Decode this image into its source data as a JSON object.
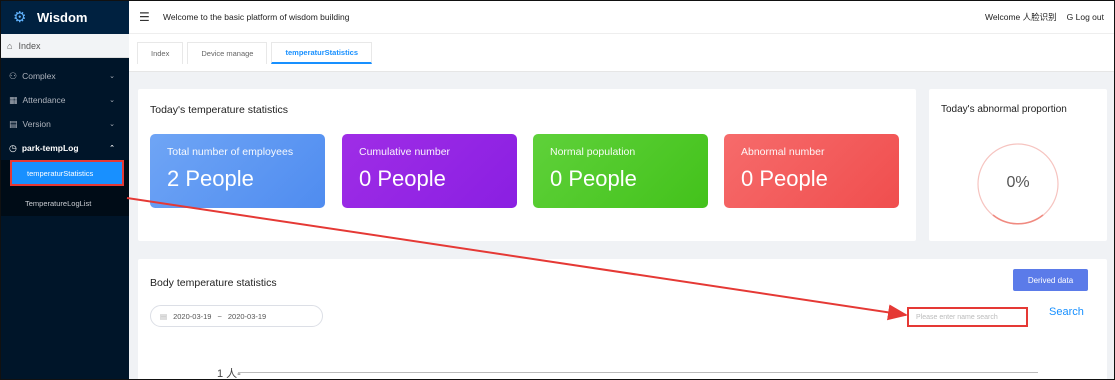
{
  "app": {
    "name": "Wisdom"
  },
  "header": {
    "welcome_text": "Welcome to the basic platform of wisdom building",
    "user_greeting": "Welcome 人脸识别",
    "logout_label": "Log out"
  },
  "sidebar": {
    "index_label": "Index",
    "items": [
      {
        "label": "Complex",
        "icon": "cluster-icon"
      },
      {
        "label": "Attendance",
        "icon": "calendar-icon"
      },
      {
        "label": "Version",
        "icon": "document-icon"
      },
      {
        "label": "park-tempLog",
        "icon": "clock-icon"
      }
    ],
    "sub_items": [
      {
        "label": "temperaturStatistics"
      },
      {
        "label": "TemperatureLogList"
      }
    ]
  },
  "tabs": [
    {
      "label": "Index"
    },
    {
      "label": "Device manage"
    },
    {
      "label": "temperaturStatistics"
    }
  ],
  "stats": {
    "title": "Today's temperature statistics",
    "cards": [
      {
        "label": "Total number of employees",
        "value": "2 People",
        "color": "#5b95f2"
      },
      {
        "label": "Cumulative number",
        "value": "0 People",
        "color": "#9326e4"
      },
      {
        "label": "Normal population",
        "value": "0 People",
        "color": "#4fc828"
      },
      {
        "label": "Abnormal number",
        "value": "0 People",
        "color": "#f25656"
      }
    ]
  },
  "abnormal": {
    "title": "Today's abnormal proportion",
    "percent": "0%"
  },
  "body_temp": {
    "title": "Body temperature statistics",
    "derived_label": "Derived data",
    "date_start": "2020-03-19",
    "date_sep": "~",
    "date_end": "2020-03-19",
    "search_placeholder": "Please enter name search",
    "search_label": "Search",
    "y_tick": "1 人-"
  }
}
